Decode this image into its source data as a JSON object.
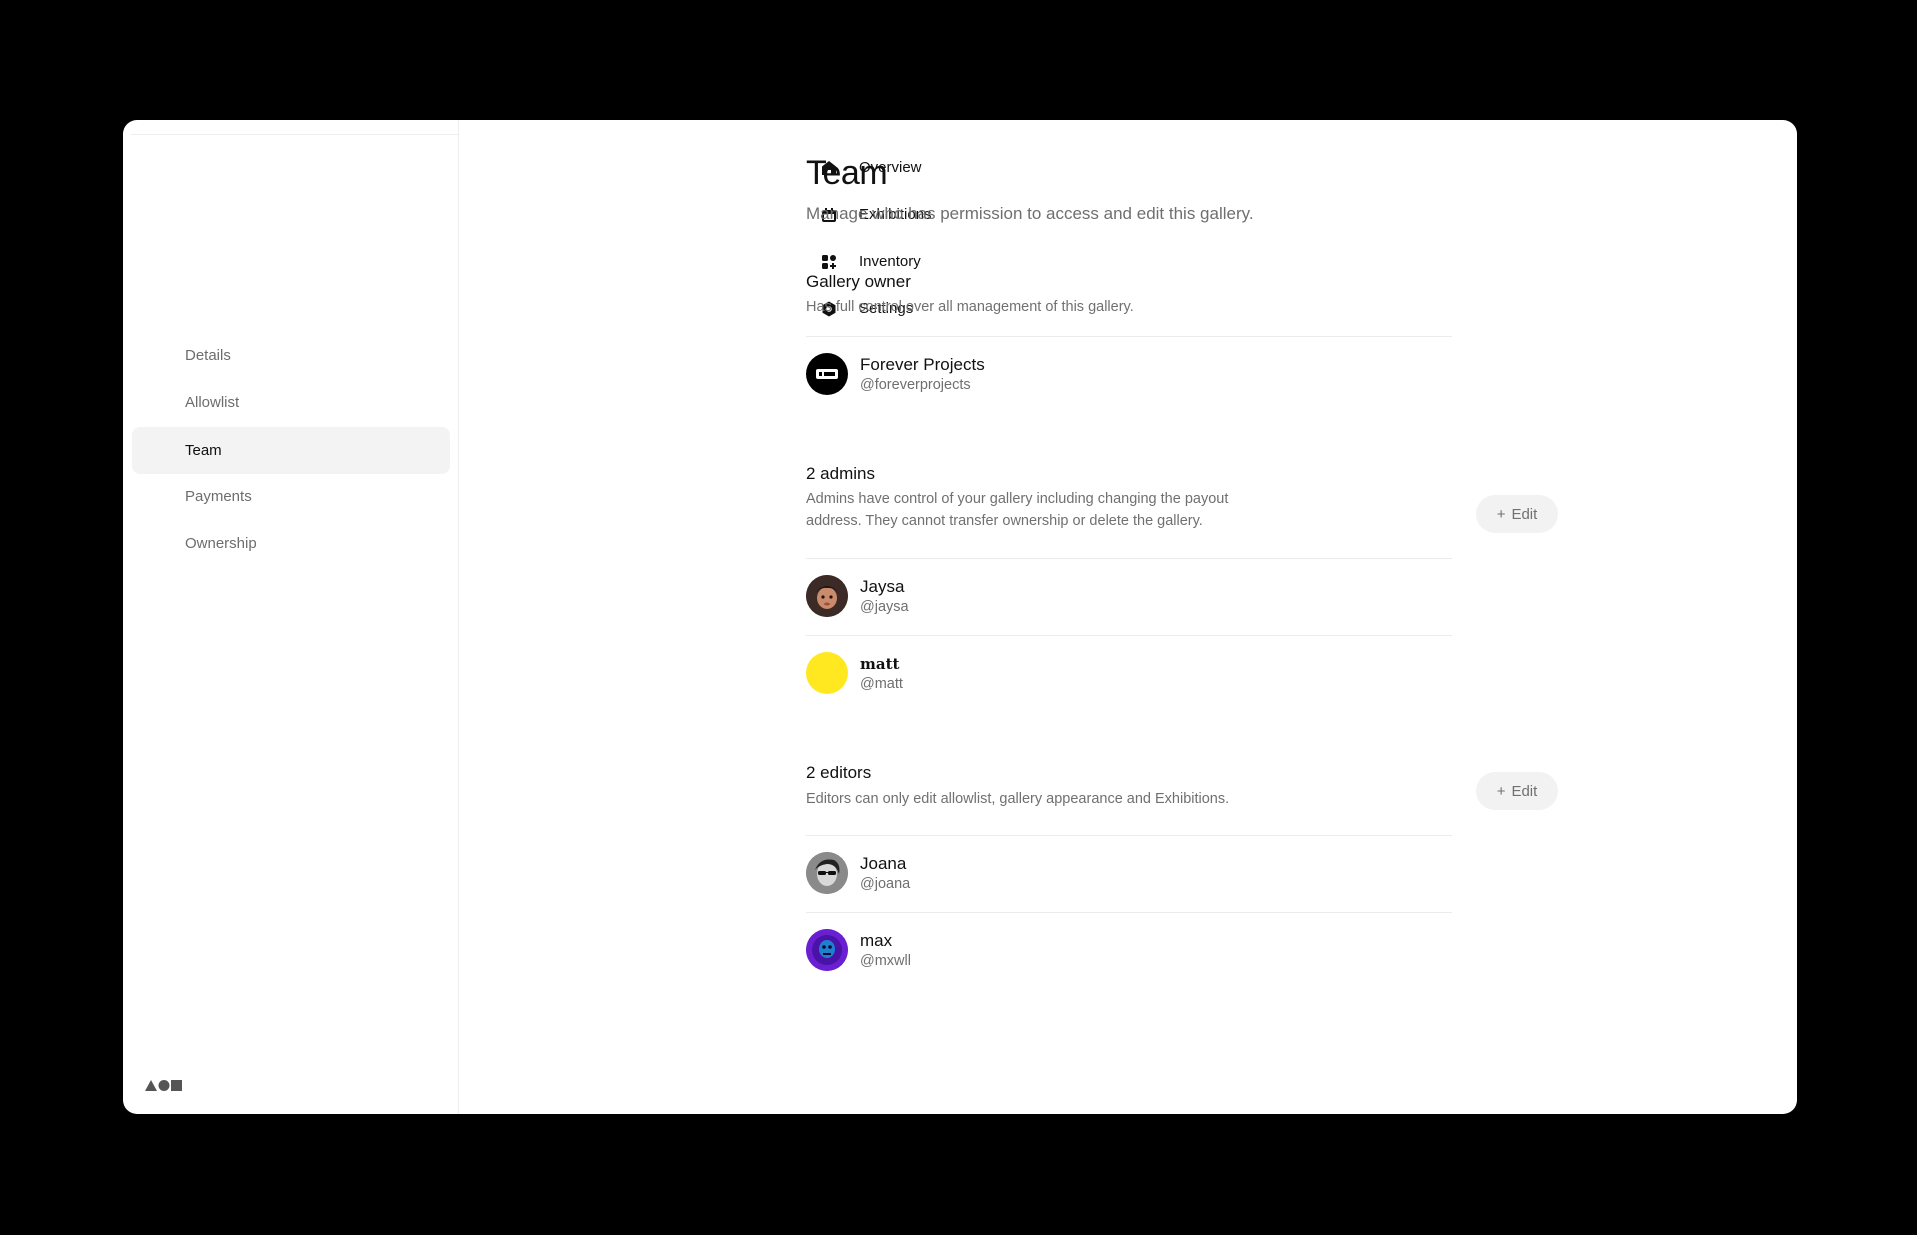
{
  "sidebar": {
    "items": [
      {
        "label": "Overview",
        "icon": "home-icon"
      },
      {
        "label": "Exhibitions",
        "icon": "calendar-icon"
      },
      {
        "label": "Inventory",
        "icon": "grid-plus-icon"
      },
      {
        "label": "Settings",
        "icon": "settings-hexagon-icon"
      }
    ],
    "sub_items": [
      {
        "label": "Details"
      },
      {
        "label": "Allowlist"
      },
      {
        "label": "Team",
        "active": true
      },
      {
        "label": "Payments"
      },
      {
        "label": "Ownership"
      }
    ],
    "logo_icon": "shapes-logo-icon"
  },
  "page": {
    "title": "Team",
    "subtitle": "Manage who has permission to access and edit this gallery."
  },
  "owner": {
    "title": "Gallery owner",
    "description": "Has full control over all management of this gallery.",
    "member": {
      "name": "Forever Projects",
      "handle": "@foreverprojects",
      "avatar_color": "#000000"
    }
  },
  "admins": {
    "title": "2 admins",
    "description": "Admins have control of your gallery including changing the payout address. They cannot transfer ownership or delete the gallery.",
    "edit_label": "Edit",
    "members": [
      {
        "name": "Jaysa",
        "handle": "@jaysa",
        "avatar_color": "#3b2a25"
      },
      {
        "name": "matt",
        "handle": "@matt",
        "avatar_color": "#ffe81f"
      }
    ]
  },
  "editors": {
    "title": "2 editors",
    "description": "Editors can only edit allowlist, gallery appearance and Exhibitions.",
    "edit_label": "Edit",
    "members": [
      {
        "name": "Joana",
        "handle": "@joana",
        "avatar_color": "#6e6e6e"
      },
      {
        "name": "max",
        "handle": "@mxwll",
        "avatar_color": "#6a1fd1"
      }
    ]
  }
}
